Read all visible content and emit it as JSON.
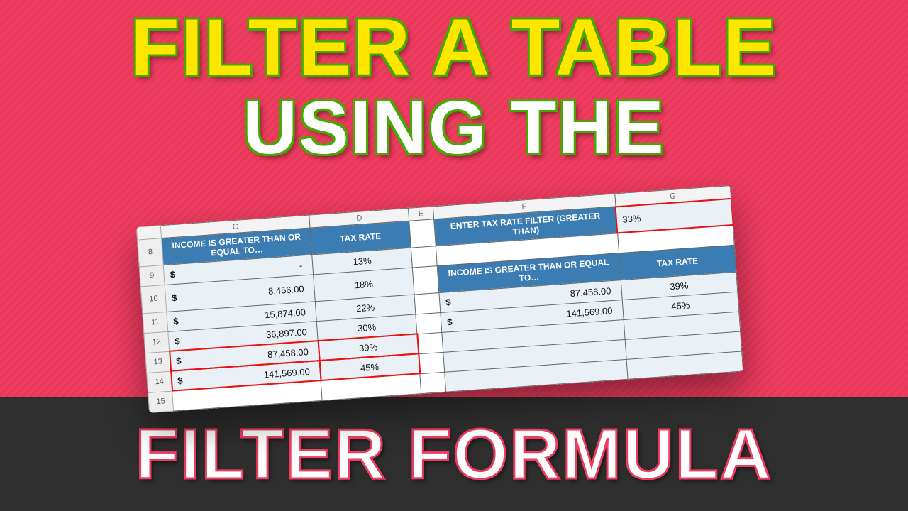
{
  "titles": {
    "line1": "FILTER A TABLE",
    "line2": "USING THE",
    "line3": "FILTER FORMULA"
  },
  "columns": {
    "c": "C",
    "d": "D",
    "e": "E",
    "f": "F",
    "g": "G"
  },
  "rownums": {
    "r8": "8",
    "r9": "9",
    "r10": "10",
    "r11": "11",
    "r12": "12",
    "r13": "13",
    "r14": "14",
    "r15": "15"
  },
  "leftTable": {
    "header1": "INCOME IS GREATER THAN OR EQUAL TO…",
    "header2": "TAX RATE",
    "rows": [
      {
        "sym": "$",
        "income": "-",
        "rate": "13%"
      },
      {
        "sym": "$",
        "income": "8,456.00",
        "rate": "18%"
      },
      {
        "sym": "$",
        "income": "15,874.00",
        "rate": "22%"
      },
      {
        "sym": "$",
        "income": "36,897.00",
        "rate": "30%"
      },
      {
        "sym": "$",
        "income": "87,458.00",
        "rate": "39%"
      },
      {
        "sym": "$",
        "income": "141,569.00",
        "rate": "45%"
      }
    ]
  },
  "filter": {
    "label": "ENTER TAX RATE FILTER (GREATER THAN)",
    "value": "33%"
  },
  "rightTable": {
    "header1": "INCOME IS GREATER THAN OR EQUAL TO…",
    "header2": "TAX RATE",
    "rows": [
      {
        "sym": "$",
        "income": "87,458.00",
        "rate": "39%"
      },
      {
        "sym": "$",
        "income": "141,569.00",
        "rate": "45%"
      }
    ]
  }
}
